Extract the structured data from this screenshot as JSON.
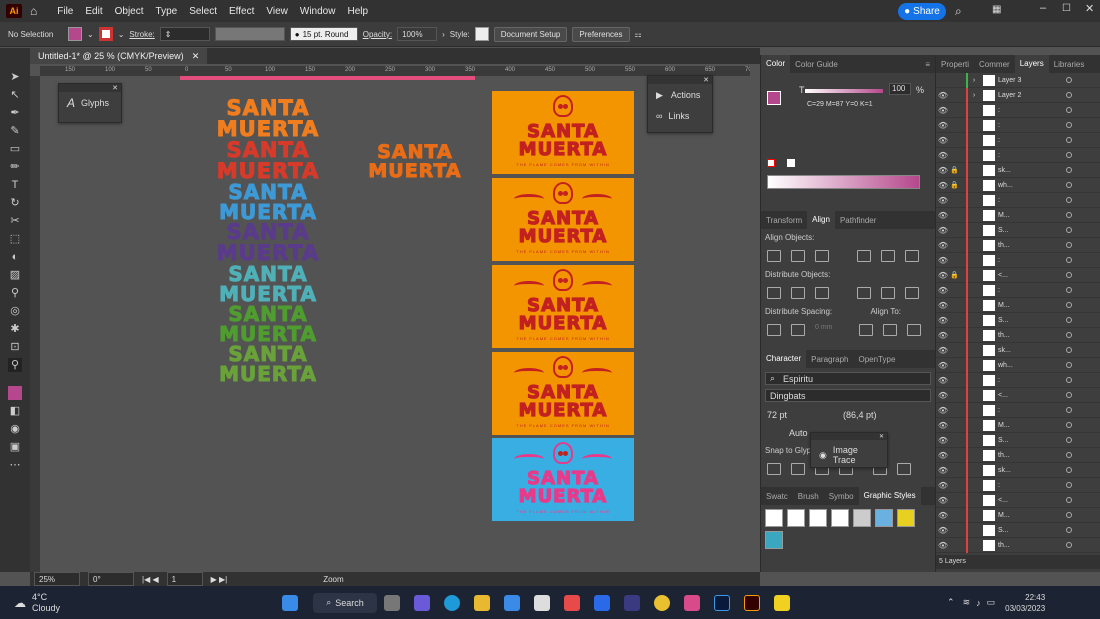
{
  "menubar": {
    "logo": "Ai",
    "items": [
      "File",
      "Edit",
      "Object",
      "Type",
      "Select",
      "Effect",
      "View",
      "Window",
      "Help"
    ],
    "share": "Share"
  },
  "control": {
    "selection": "No Selection",
    "stroke_label": "Stroke:",
    "brush": "15 pt. Round",
    "opacity_label": "Opacity:",
    "opacity": "100%",
    "style_label": "Style:",
    "doc_setup": "Document Setup",
    "preferences": "Preferences"
  },
  "document": {
    "tab": "Untitled-1* @ 25 % (CMYK/Preview)",
    "ruler_ticks": [
      "150",
      "100",
      "50",
      "0",
      "50",
      "100",
      "150",
      "200",
      "250",
      "300",
      "350",
      "400",
      "450",
      "500",
      "550",
      "600",
      "650",
      "700"
    ]
  },
  "floating": {
    "glyphs": "Glyphs",
    "actions": "Actions",
    "links": "Links",
    "image_trace": "Image Trace"
  },
  "artwork": {
    "word1": "SANTA",
    "word2": "MUERTA",
    "tagline": "THE FLAME COMES FROM WITHIN",
    "colors": [
      "#f07d1e",
      "#d83a2a",
      "#3d9ad6",
      "#5a3a8a",
      "#4fb0b8",
      "#4e9d2e",
      "#6aa23a"
    ],
    "big_color": "#e86d16",
    "card_bg": "#f39500",
    "card_bg_blue": "#38aee3",
    "card_ink": "#c32020",
    "card_ink_pink": "#e83a8a"
  },
  "color_panel": {
    "tabs": [
      "Color",
      "Color Guide"
    ],
    "tint_label": "T",
    "tint": "100",
    "pct": "%",
    "cmyk": "C=29 M=87 Y=0 K=1"
  },
  "align_panel": {
    "tabs": [
      "Transform",
      "Align",
      "Pathfinder"
    ],
    "align_objects": "Align Objects:",
    "distribute_objects": "Distribute Objects:",
    "distribute_spacing": "Distribute Spacing:",
    "align_to": "Align To:",
    "spacing": "0 mm"
  },
  "character_panel": {
    "tabs": [
      "Character",
      "Paragraph",
      "OpenType"
    ],
    "font": "Espiritu",
    "style": "Dingbats",
    "size": "72 pt",
    "leading": "(86,4 pt)",
    "tracking": "Auto",
    "snap": "Snap to Glyph"
  },
  "styles_panel": {
    "tabs": [
      "Swatc",
      "Brush",
      "Symbo",
      "Graphic Styles"
    ]
  },
  "layers_panel": {
    "tabs": [
      "Properti",
      "Commer",
      "Layers",
      "Libraries"
    ],
    "footer": "5 Layers",
    "rows": [
      {
        "name": "Layer 3"
      },
      {
        "name": "Layer 2"
      },
      {
        "name": ":"
      },
      {
        "name": ":"
      },
      {
        "name": ":"
      },
      {
        "name": ":"
      },
      {
        "name": "sk..."
      },
      {
        "name": "wh..."
      },
      {
        "name": ":"
      },
      {
        "name": "M..."
      },
      {
        "name": "S..."
      },
      {
        "name": "th..."
      },
      {
        "name": ":"
      },
      {
        "name": "<..."
      },
      {
        "name": ":"
      },
      {
        "name": "M..."
      },
      {
        "name": "S..."
      },
      {
        "name": "th..."
      },
      {
        "name": "sk..."
      },
      {
        "name": "wh..."
      },
      {
        "name": ":"
      },
      {
        "name": "<..."
      },
      {
        "name": ":"
      },
      {
        "name": "M..."
      },
      {
        "name": "S..."
      },
      {
        "name": "th..."
      },
      {
        "name": "sk..."
      },
      {
        "name": ":"
      },
      {
        "name": "<..."
      },
      {
        "name": "M..."
      },
      {
        "name": "S..."
      },
      {
        "name": "th..."
      }
    ]
  },
  "statusbar": {
    "zoom": "25%",
    "angle": "0°",
    "page": "1",
    "mode": "Zoom"
  },
  "taskbar": {
    "temp": "4°C",
    "weather": "Cloudy",
    "search": "Search",
    "time": "22:43",
    "date": "03/03/2023"
  }
}
